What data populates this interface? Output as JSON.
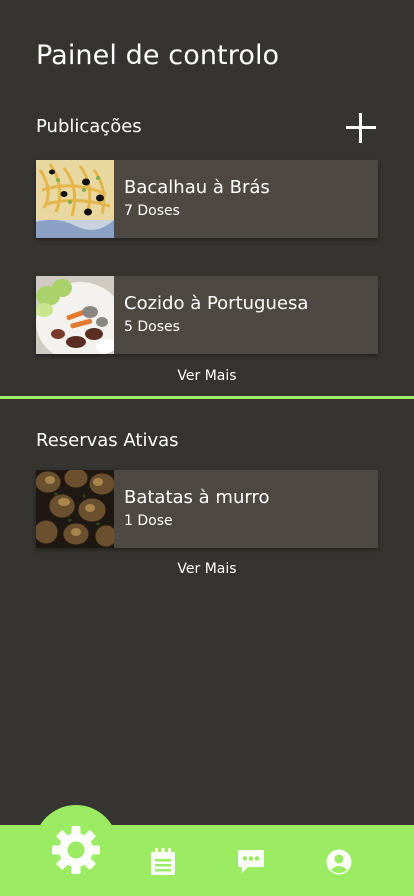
{
  "header": {
    "title": "Painel de controlo"
  },
  "publications": {
    "title": "Publicações",
    "add_icon": "plus-icon",
    "items": [
      {
        "title": "Bacalhau à Brás",
        "subtitle": "7 Doses",
        "image": "bacalhau-photo"
      },
      {
        "title": "Cozido à Portuguesa",
        "subtitle": "5 Doses",
        "image": "cozido-photo"
      }
    ],
    "see_more": "Ver Mais"
  },
  "reservations": {
    "title": "Reservas Ativas",
    "items": [
      {
        "title": "Batatas à murro",
        "subtitle": "1 Dose",
        "image": "batatas-photo"
      }
    ],
    "see_more": "Ver Mais"
  },
  "bottom_nav": {
    "items": [
      {
        "icon": "gear-icon",
        "active": true
      },
      {
        "icon": "clipboard-icon"
      },
      {
        "icon": "chat-icon"
      },
      {
        "icon": "profile-icon"
      }
    ]
  },
  "colors": {
    "background": "#353431",
    "card": "#4e4843",
    "accent": "#9bec63"
  }
}
